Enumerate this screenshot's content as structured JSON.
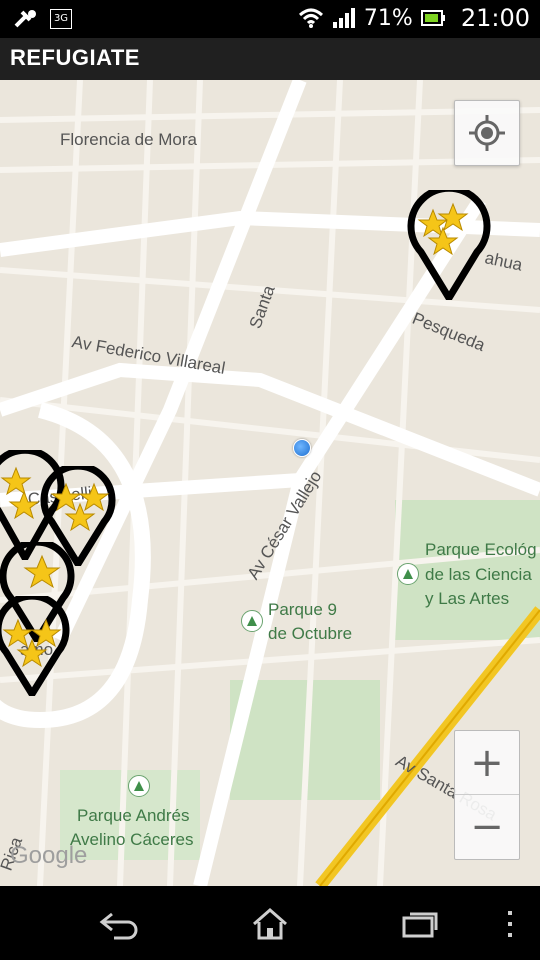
{
  "status_bar": {
    "network_label": "3G",
    "battery_percent": "71%",
    "time": "21:00",
    "icons": [
      "tools-icon",
      "3g-icon",
      "wifi-icon",
      "signal-icon",
      "battery-icon"
    ]
  },
  "action_bar": {
    "title": "REFUGIATE"
  },
  "map": {
    "street_labels": {
      "florencia": "Florencia de Mora",
      "federico": "Av Federico Villareal",
      "santa": "Santa",
      "hualcahua": "ahua",
      "pesqueda": "Pesqueda",
      "cesar_vallejo": "Av César Vallejo",
      "santa_rosa": "Av Santa Rosa",
      "rica": "Rica",
      "casinelli": "Casinelli",
      "lamo": "amo"
    },
    "parks": {
      "ecologico_line1": "Parque Ecológ",
      "ecologico_line2": "de las Ciencia",
      "ecologico_line3": "y Las Artes",
      "nueve_line1": "Parque 9",
      "nueve_line2": "de Octubre",
      "andres_line1": "Parque Andrés",
      "andres_line2": "Avelino Cáceres"
    },
    "google_logo": "Google",
    "zoom_in_label": "+",
    "zoom_out_label": "−",
    "markers": [
      "refuge-marker",
      "refuge-marker",
      "refuge-marker",
      "refuge-marker",
      "refuge-marker"
    ]
  },
  "nav_bar": {
    "icons": [
      "back-icon",
      "home-icon",
      "recent-apps-icon",
      "menu-icon"
    ]
  },
  "colors": {
    "map_bg": "#ebe6dc",
    "road": "#ffffff",
    "highway": "#f2c623",
    "park": "#cfe3c4",
    "marker_star": "#f5c518"
  }
}
